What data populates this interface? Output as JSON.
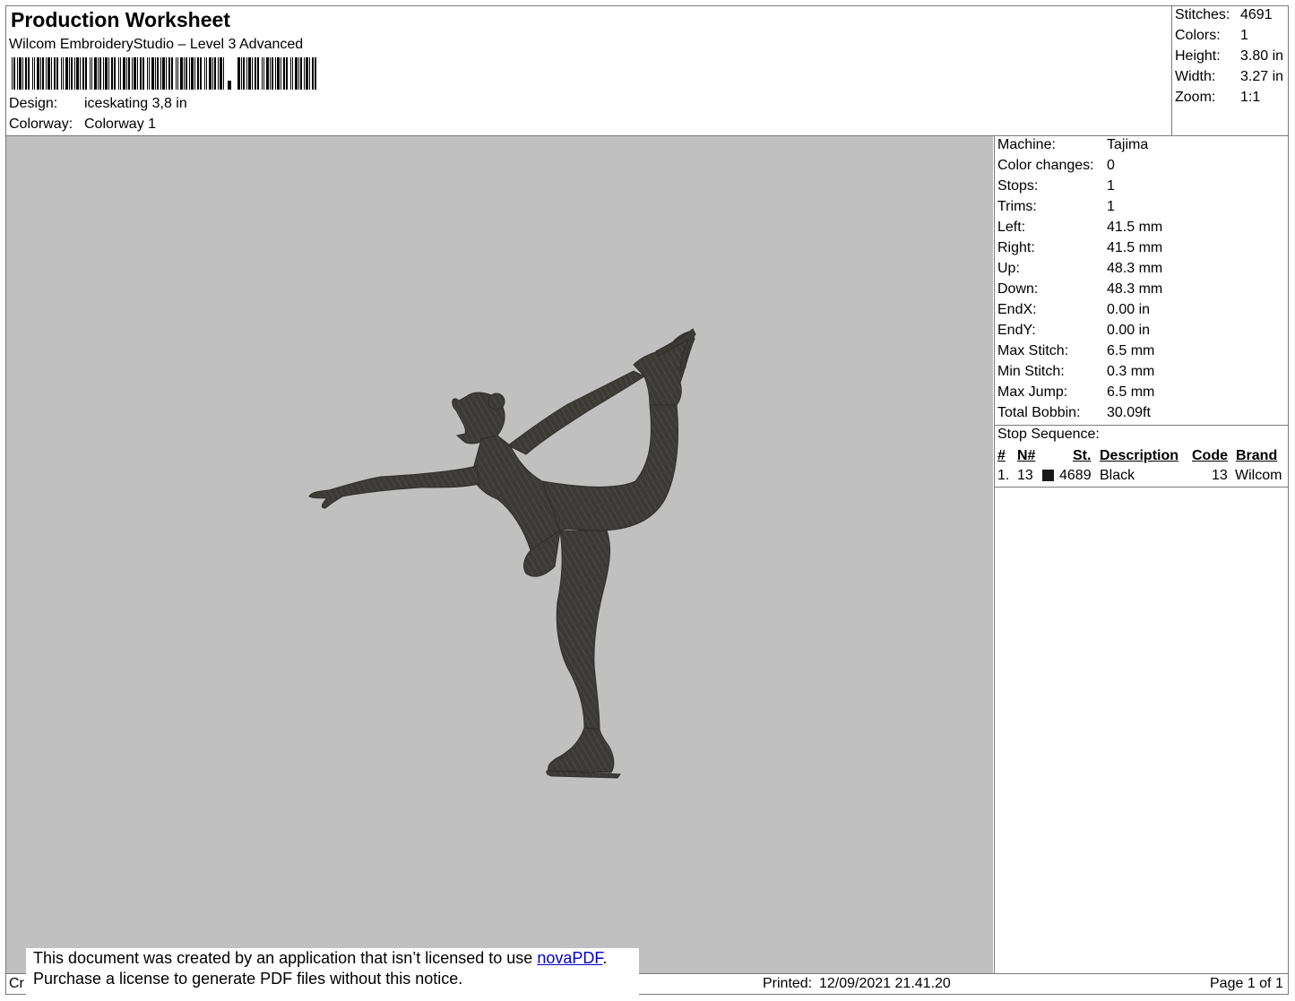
{
  "header": {
    "title": "Production Worksheet",
    "software": "Wilcom EmbroideryStudio – Level 3 Advanced",
    "design_label": "Design:",
    "design_value": "iceskating 3,8 in",
    "colorway_label": "Colorway:",
    "colorway_value": "Colorway 1"
  },
  "summary": [
    {
      "label": "Stitches:",
      "value": "4691"
    },
    {
      "label": "Colors:",
      "value": "1"
    },
    {
      "label": "Height:",
      "value": "3.80 in"
    },
    {
      "label": "Width:",
      "value": "3.27 in"
    },
    {
      "label": "Zoom:",
      "value": "1:1"
    }
  ],
  "machine_info": [
    {
      "label": "Machine:",
      "value": "Tajima"
    },
    {
      "label": "Color changes:",
      "value": "0"
    },
    {
      "label": "Stops:",
      "value": "1"
    },
    {
      "label": "Trims:",
      "value": "1"
    },
    {
      "label": "Left:",
      "value": "41.5 mm"
    },
    {
      "label": "Right:",
      "value": "41.5 mm"
    },
    {
      "label": "Up:",
      "value": "48.3 mm"
    },
    {
      "label": "Down:",
      "value": "48.3 mm"
    },
    {
      "label": "EndX:",
      "value": "0.00 in"
    },
    {
      "label": "EndY:",
      "value": "0.00 in"
    },
    {
      "label": "Max Stitch:",
      "value": "6.5 mm"
    },
    {
      "label": "Min Stitch:",
      "value": "0.3 mm"
    },
    {
      "label": "Max Jump:",
      "value": "6.5 mm"
    },
    {
      "label": "Total Bobbin:",
      "value": "30.09ft"
    }
  ],
  "stop_sequence": {
    "title": "Stop Sequence:",
    "headers": {
      "num": "#",
      "n": "N#",
      "st": "St.",
      "description": "Description",
      "code": "Code",
      "brand": "Brand"
    },
    "rows": [
      {
        "num": "1.",
        "n": "13",
        "color": "#1a1a1a",
        "st": "4689",
        "description": "Black",
        "code": "13",
        "brand": "Wilcom"
      }
    ]
  },
  "design": {
    "name": "figure skater silhouette",
    "thread_color": "#3b3a36",
    "background": "#c0c0c0"
  },
  "notice": {
    "line1_prefix": "This document was created by an application that isn’t licensed to use ",
    "link": "novaPDF",
    "line1_suffix": ".",
    "line2": "Purchase a license to generate PDF files without this notice."
  },
  "footer": {
    "created_fragment": "Cr",
    "printed_label": "Printed:",
    "printed_value": "12/09/2021 21.41.20",
    "page": "Page 1 of 1"
  }
}
